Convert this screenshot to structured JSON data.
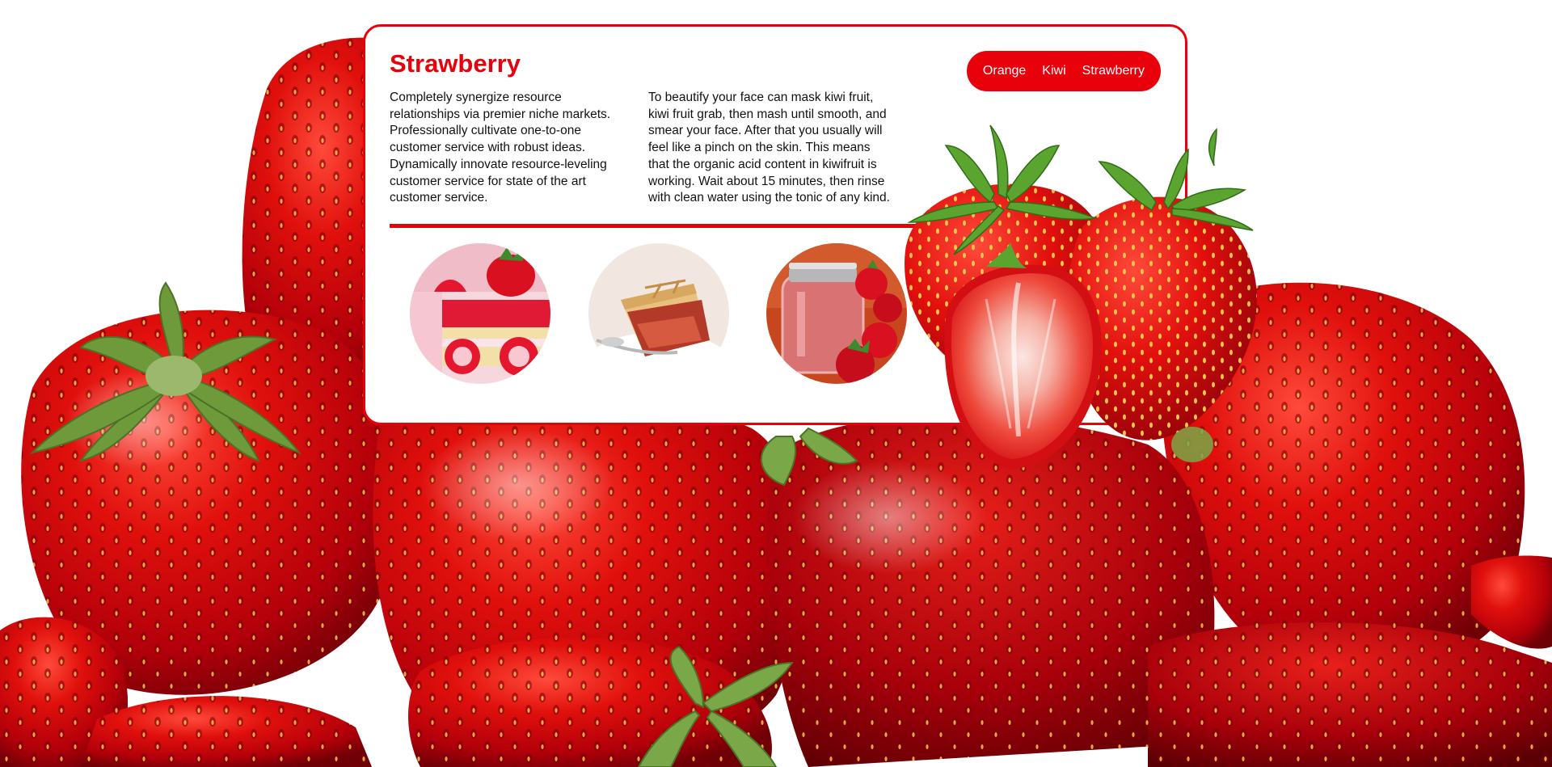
{
  "card": {
    "title": "Strawberry",
    "paragraph_left": "Completely synergize resource relationships via premier niche markets. Professionally cultivate one-to-one customer service with robust ideas. Dynamically innovate resource-leveling customer service for state of the art customer service.",
    "paragraph_right": "To beautify your face can mask kiwi fruit, kiwi fruit grab, then mash until smooth, and smear your face. After that you usually will feel like a pinch on the skin. This means that the organic acid content in kiwifruit is working. Wait about 15 minutes, then rinse with clean water using the tonic of any kind."
  },
  "nav": {
    "items": [
      {
        "label": "Orange"
      },
      {
        "label": "Kiwi"
      },
      {
        "label": "Strawberry"
      }
    ]
  },
  "thumbnails": [
    {
      "icon": "strawberry-cake-image"
    },
    {
      "icon": "strawberry-pie-image"
    },
    {
      "icon": "strawberry-jam-jar-image"
    }
  ],
  "colors": {
    "accent": "#e8000b",
    "background": "#ffffff",
    "text": "#111111"
  }
}
